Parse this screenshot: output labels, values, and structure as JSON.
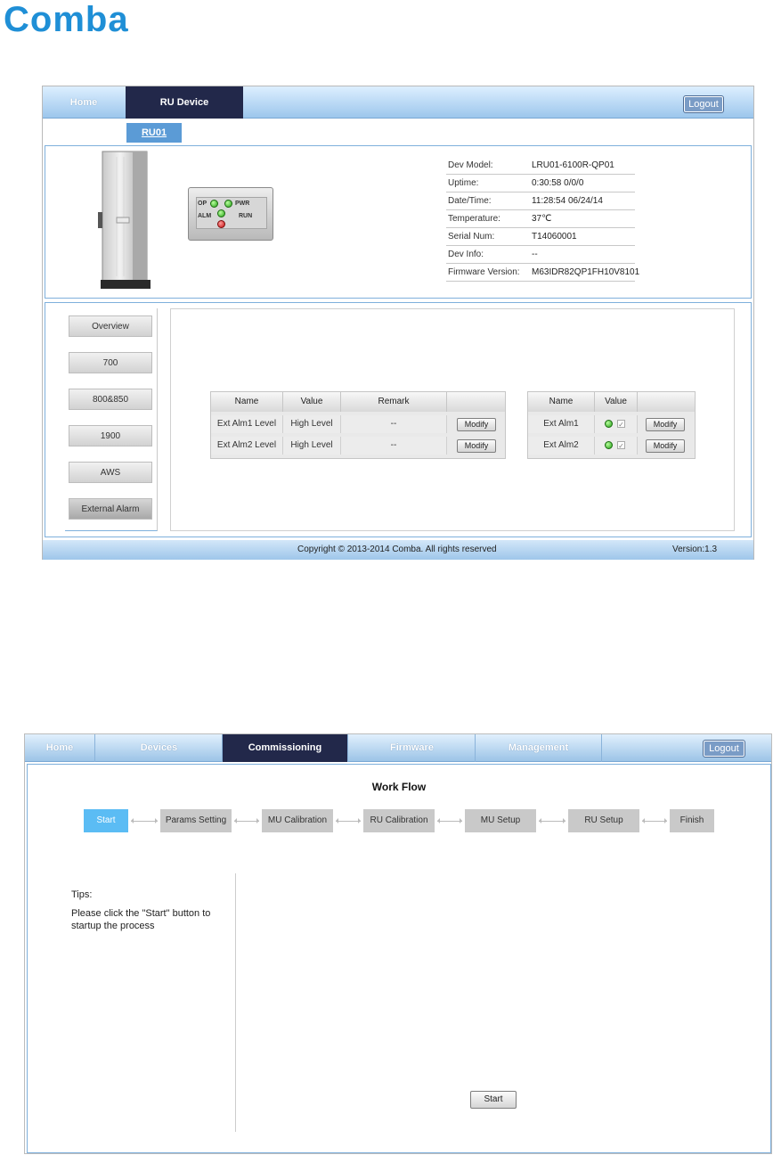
{
  "logo": {
    "text": "Comba"
  },
  "ru_screen": {
    "nav": {
      "home": "Home",
      "ru_device": "RU Device",
      "logout": "Logout"
    },
    "subtab": "RU01",
    "leds": {
      "op": "OP",
      "pwr": "PWR",
      "alm": "ALM",
      "run": "RUN"
    },
    "device_info": [
      {
        "label": "Dev Model:",
        "value": "LRU01-6100R-QP01"
      },
      {
        "label": "Uptime:",
        "value": "0:30:58 0/0/0"
      },
      {
        "label": "Date/Time:",
        "value": "11:28:54 06/24/14"
      },
      {
        "label": "Temperature:",
        "value": "37℃"
      },
      {
        "label": "Serial Num:",
        "value": "T14060001"
      },
      {
        "label": "Dev Info:",
        "value": "--"
      },
      {
        "label": "Firmware Version:",
        "value": "M63IDR82QP1FH10V8101"
      }
    ],
    "side_menu": [
      "Overview",
      "700",
      "800&850",
      "1900",
      "AWS",
      "External Alarm"
    ],
    "level_table": {
      "headers": [
        "Name",
        "Value",
        "Remark",
        ""
      ],
      "rows": [
        {
          "name": "Ext Alm1 Level",
          "value": "High Level",
          "remark": "--",
          "action": "Modify"
        },
        {
          "name": "Ext Alm2 Level",
          "value": "High Level",
          "remark": "--",
          "action": "Modify"
        }
      ]
    },
    "alarm_table": {
      "headers": [
        "Name",
        "Value",
        ""
      ],
      "rows": [
        {
          "name": "Ext Alm1",
          "action": "Modify",
          "check": "✓"
        },
        {
          "name": "Ext Alm2",
          "action": "Modify",
          "check": "✓"
        }
      ]
    },
    "footer": {
      "copyright": "Copyright © 2013-2014 Comba. All rights reserved",
      "version": "Version:1.3"
    }
  },
  "commissioning_screen": {
    "nav": [
      "Home",
      "Devices",
      "Commissioning",
      "Firmware",
      "Management"
    ],
    "logout": "Logout",
    "workflow_title": "Work Flow",
    "steps": [
      "Start",
      "Params Setting",
      "MU Calibration",
      "RU Calibration",
      "MU Setup",
      "RU Setup",
      "Finish"
    ],
    "tips_title": "Tips:",
    "tips_text": "Please click the \"Start\" button to startup the process",
    "start_button": "Start"
  },
  "colors": {
    "nav_active": "#22284a",
    "accent_blue": "#5bbcf4",
    "subtab_blue": "#5b9bd6",
    "panel_border": "#7fb0dc"
  }
}
